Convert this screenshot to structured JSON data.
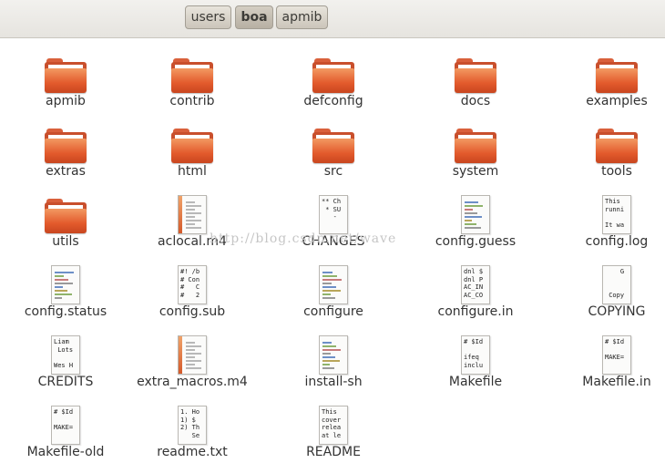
{
  "breadcrumbs": [
    "users",
    "boa",
    "apmib"
  ],
  "watermark": "http://blog.csdn.net/wave",
  "items": [
    {
      "name": "apmib",
      "kind": "folder"
    },
    {
      "name": "contrib",
      "kind": "folder"
    },
    {
      "name": "defconfig",
      "kind": "folder"
    },
    {
      "name": "docs",
      "kind": "folder"
    },
    {
      "name": "examples",
      "kind": "folder"
    },
    {
      "name": "extras",
      "kind": "folder"
    },
    {
      "name": "html",
      "kind": "folder"
    },
    {
      "name": "src",
      "kind": "folder"
    },
    {
      "name": "system",
      "kind": "folder"
    },
    {
      "name": "tools",
      "kind": "folder"
    },
    {
      "name": "utils",
      "kind": "folder"
    },
    {
      "name": "aclocal.m4",
      "kind": "m4"
    },
    {
      "name": "CHANGES",
      "kind": "text",
      "preview": "** Ch\n * SU\n   -"
    },
    {
      "name": "config.guess",
      "kind": "script"
    },
    {
      "name": "config.log",
      "kind": "text",
      "preview": "This\nrunni\n\nIt wa"
    },
    {
      "name": "config.status",
      "kind": "script"
    },
    {
      "name": "config.sub",
      "kind": "text",
      "preview": "#! /b\n# Con\n#   C\n#   2"
    },
    {
      "name": "configure",
      "kind": "script"
    },
    {
      "name": "configure.in",
      "kind": "text",
      "preview": "dnl $\ndnl P\nAC_IN\nAC_CO"
    },
    {
      "name": "COPYING",
      "kind": "text",
      "preview": "    G\n\n\n Copy"
    },
    {
      "name": "CREDITS",
      "kind": "text",
      "preview": "Liam\n Lots\n\nWes H"
    },
    {
      "name": "extra_macros.m4",
      "kind": "m4"
    },
    {
      "name": "install-sh",
      "kind": "script"
    },
    {
      "name": "Makefile",
      "kind": "text",
      "preview": "# $Id\n\nifeq\ninclu"
    },
    {
      "name": "Makefile.in",
      "kind": "text",
      "preview": "# $Id\n\nMAKE="
    },
    {
      "name": "Makefile-old",
      "kind": "text",
      "preview": "# $Id\n\nMAKE="
    },
    {
      "name": "readme.txt",
      "kind": "text",
      "preview": "1. Ho\n1) $\n2) Th\n   Se"
    },
    {
      "name": "README",
      "kind": "text",
      "preview": "This\ncover\nrelea\nat le"
    }
  ]
}
